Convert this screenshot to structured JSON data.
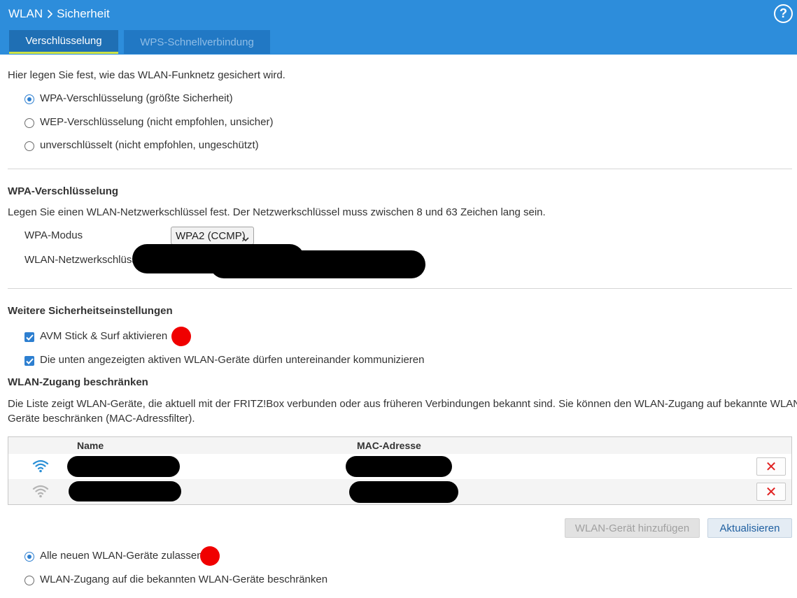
{
  "header": {
    "breadcrumb": [
      "WLAN",
      "Sicherheit"
    ],
    "help_icon": "question-circle-icon",
    "tabs": [
      {
        "label": "Verschlüsselung",
        "active": true
      },
      {
        "label": "WPS-Schnellverbindung",
        "active": false
      }
    ],
    "colors": {
      "header_bg": "#2d8ddb",
      "tab_active_bg": "#1f6fb4",
      "tab_active_underline": "#cfe344"
    }
  },
  "encryption": {
    "intro": "Hier legen Sie fest, wie das WLAN-Funknetz gesichert wird.",
    "options": [
      {
        "label": "WPA-Verschlüsselung (größte Sicherheit)",
        "checked": true
      },
      {
        "label": "WEP-Verschlüsselung (nicht empfohlen, unsicher)",
        "checked": false
      },
      {
        "label": "unverschlüsselt (nicht empfohlen, ungeschützt)",
        "checked": false
      }
    ]
  },
  "wpa": {
    "heading": "WPA-Verschlüsselung",
    "description": "Legen Sie einen WLAN-Netzwerkschlüssel fest. Der Netzwerkschlüssel muss zwischen 8 und 63 Zeichen lang sein.",
    "mode_label": "WPA-Modus",
    "mode_value": "WPA2 (CCMP)",
    "key_label": "WLAN-Netzwerkschlüss"
  },
  "further": {
    "heading": "Weitere Sicherheitseinstellungen",
    "checkboxes": [
      {
        "label": "AVM Stick & Surf aktivieren",
        "checked": true
      },
      {
        "label": "Die unten angezeigten aktiven WLAN-Geräte dürfen untereinander kommunizieren",
        "checked": true
      }
    ]
  },
  "access": {
    "heading": "WLAN-Zugang beschränken",
    "description_line1": "Die Liste zeigt WLAN-Geräte, die aktuell mit der FRITZ!Box verbunden oder aus früheren Verbindungen bekannt sind. Sie können den WLAN-Zugang auf bekannte WLAN-",
    "description_line2": "Geräte beschränken (MAC-Adressfilter).",
    "table": {
      "columns": [
        "Name",
        "MAC-Adresse"
      ],
      "rows": [
        {
          "status_icon": "wifi-active-icon",
          "status_color": "#2a8fd6",
          "delete_icon": "close-x-icon"
        },
        {
          "status_icon": "wifi-inactive-icon",
          "status_color": "#b4b4b4",
          "delete_icon": "close-x-icon"
        }
      ]
    },
    "buttons": {
      "add": "WLAN-Gerät hinzufügen",
      "refresh": "Aktualisieren"
    },
    "options": [
      {
        "label": "Alle neuen WLAN-Geräte zulassen",
        "checked": true
      },
      {
        "label": "WLAN-Zugang auf die bekannten WLAN-Geräte beschränken",
        "checked": false
      }
    ]
  }
}
